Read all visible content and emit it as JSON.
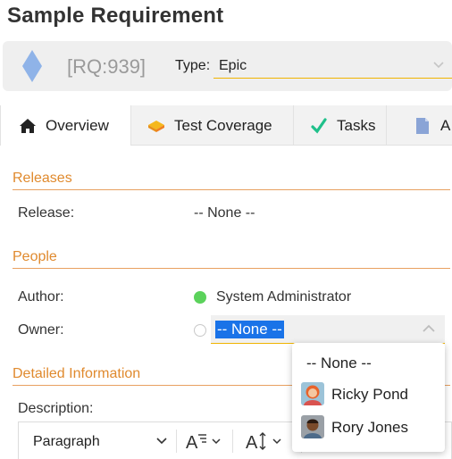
{
  "page": {
    "title": "Sample Requirement"
  },
  "header": {
    "requirement_id": "[RQ:939]",
    "type_label": "Type:",
    "type_value": "Epic",
    "diamond_color": "#8fb3e8"
  },
  "tabs": [
    {
      "label": "Overview",
      "icon": "home-icon",
      "active": true
    },
    {
      "label": "Test Coverage",
      "icon": "test-coverage-icon",
      "active": false
    },
    {
      "label": "Tasks",
      "icon": "checkmark-icon",
      "active": false
    },
    {
      "label": "A",
      "icon": "document-icon",
      "active": false
    }
  ],
  "sections": {
    "releases": {
      "heading": "Releases",
      "release_label": "Release:",
      "release_value": "-- None --"
    },
    "people": {
      "heading": "People",
      "author_label": "Author:",
      "author_value": "System Administrator",
      "author_status_color": "#5bd25b",
      "owner_label": "Owner:",
      "owner_value": "-- None --"
    },
    "detailed": {
      "heading": "Detailed Information",
      "description_label": "Description:"
    }
  },
  "owner_dropdown": {
    "options": [
      {
        "label": "-- None --",
        "avatar": null
      },
      {
        "label": "Ricky Pond",
        "avatar": "ricky-pond-avatar"
      },
      {
        "label": "Rory Jones",
        "avatar": "rory-jones-avatar"
      }
    ]
  },
  "editor_toolbar": {
    "paragraph_style": "Paragraph",
    "font_size_icon": "font-size-icon",
    "line_height_icon": "line-height-icon"
  },
  "colors": {
    "accent": "#e08a2e",
    "focus_underline": "#f0b400",
    "selection": "#1a73e8"
  }
}
